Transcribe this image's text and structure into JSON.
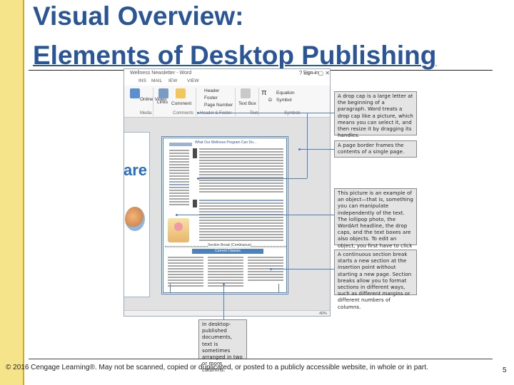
{
  "slide": {
    "title_line1": "Visual Overview:",
    "title_line2": "Elements of Desktop Publishing",
    "footer": "© 2016 Cengage Learning®. May not be scanned, copied or duplicated, or posted to a publicly accessible website, in whole or in part.",
    "page_number": "5",
    "accent_color": "#2a5597",
    "band_color": "#f6e48a"
  },
  "word_window": {
    "doc_title": "Wellness Newsletter - Word",
    "sign_in": "Sign in",
    "window_controls": "?  ▭  —  ▢  ✕",
    "tabs": [
      "INS",
      "MAIL",
      "IEW",
      "VIEW"
    ],
    "ribbon": {
      "links_label": "Links",
      "comment_label": "Comment",
      "online_video": "Online\nVideo",
      "header": "Header",
      "footer": "Footer",
      "page_number": "Page Number",
      "text_box": "Text\nBox",
      "equation": "Equation",
      "symbol": "Symbol",
      "group_media": "Media",
      "group_comments": "Comments",
      "group_header_footer": "Header & Footer",
      "group_text": "Text",
      "group_symbols": "Symbols"
    },
    "document": {
      "left_page_word": "are",
      "main_heading": "What Our Wellness Program Can Do...",
      "section_break_label": "Section Break (Continuous)",
      "columns_heading": "Current Classes"
    },
    "status_right": "40%"
  },
  "callouts": [
    {
      "id": "drop-cap",
      "text": "A drop cap is a large letter at the beginning of a paragraph. Word treats a drop cap like a picture, which means you can select it, and then resize it by dragging its handles."
    },
    {
      "id": "page-border",
      "text": "A page border frames the contents of a single page."
    },
    {
      "id": "object",
      "text": "This picture is an example of an object—that is, something you can manipulate independently of the text. The lollipop photo, the WordArt headline, the drop caps, and the text boxes are also objects. To edit an object, you first have to click it to select it."
    },
    {
      "id": "section-break",
      "text": "A continuous section break starts a new section at the insertion point without starting a new page. Section breaks allow you to format sections in different ways, such as different margins or different numbers of columns."
    },
    {
      "id": "columns",
      "text": "In desktop-published documents, text is sometimes arranged in two or more columns."
    }
  ]
}
